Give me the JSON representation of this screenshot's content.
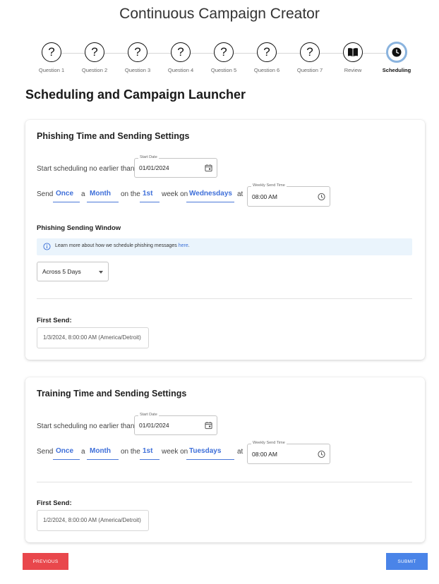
{
  "app": {
    "title": "Continuous Campaign Creator"
  },
  "stepper": {
    "steps": [
      {
        "label": "Question 1",
        "icon": "?"
      },
      {
        "label": "Question 2",
        "icon": "?"
      },
      {
        "label": "Question 3",
        "icon": "?"
      },
      {
        "label": "Question 4",
        "icon": "?"
      },
      {
        "label": "Question 5",
        "icon": "?"
      },
      {
        "label": "Question 6",
        "icon": "?"
      },
      {
        "label": "Question 7",
        "icon": "?"
      },
      {
        "label": "Review",
        "icon": "book-icon"
      },
      {
        "label": "Scheduling",
        "icon": "clock-icon",
        "active": true
      }
    ]
  },
  "page": {
    "title": "Scheduling and Campaign Launcher"
  },
  "phishing": {
    "title": "Phishing Time and Sending Settings",
    "start_label": "Start scheduling no earlier than:",
    "start_date_label": "Start Date",
    "start_date": "01/01/2024",
    "send_word": "Send",
    "frequency": "Once",
    "a_word": "a",
    "period": "Month",
    "on_the_word": "on the",
    "ordinal": "1st",
    "week_on_word": "week on",
    "weekday": "Wednesdays",
    "at_word": "at",
    "time_label": "Weekly Send Time",
    "time": "08:00 AM",
    "window_title": "Phishing Sending Window",
    "info_text": "Learn more about how we schedule phishing messages ",
    "info_link": "here",
    "info_end": ".",
    "window_value": "Across 5 Days",
    "first_send_label": "First Send:",
    "first_send_value": "1/3/2024, 8:00:00 AM (America/Detroit)"
  },
  "training": {
    "title": "Training Time and Sending Settings",
    "start_label": "Start scheduling no earlier than:",
    "start_date_label": "Start Date",
    "start_date": "01/01/2024",
    "send_word": "Send",
    "frequency": "Once",
    "a_word": "a",
    "period": "Month",
    "on_the_word": "on the",
    "ordinal": "1st",
    "week_on_word": "week on",
    "weekday": "Tuesdays",
    "at_word": "at",
    "time_label": "Weekly Send Time",
    "time": "08:00 AM",
    "first_send_label": "First Send:",
    "first_send_value": "1/2/2024, 8:00:00 AM (America/Detroit)"
  },
  "buttons": {
    "previous": "PREVIOUS",
    "submit": "SUBMIT"
  },
  "colors": {
    "accent": "#3e6fd9",
    "previous": "#e9474c",
    "submit": "#4a84e8",
    "info_bg": "#eaf4fc",
    "active_step_ring": "#8ab3de"
  }
}
